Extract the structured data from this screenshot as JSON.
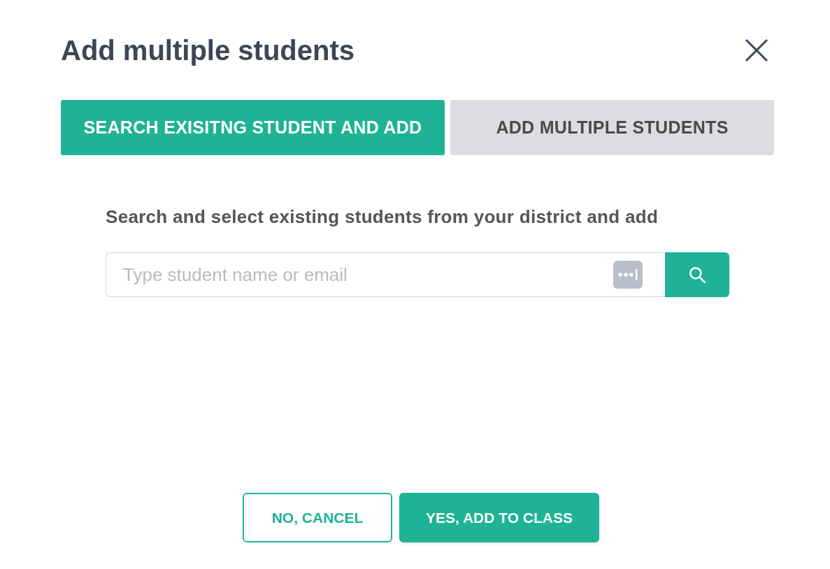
{
  "dialog": {
    "title": "Add multiple students"
  },
  "tabs": [
    {
      "label": "SEARCH EXISITNG STUDENT AND ADD",
      "selected": true
    },
    {
      "label": "ADD MULTIPLE STUDENTS",
      "selected": false
    }
  ],
  "search": {
    "instruction": "Search and select existing students from your district and add",
    "placeholder": "Type student name or email"
  },
  "buttons": [
    {
      "label": "NO, CANCEL",
      "kind": "secondary"
    },
    {
      "label": "YES, ADD TO CLASS",
      "kind": "primary"
    }
  ]
}
